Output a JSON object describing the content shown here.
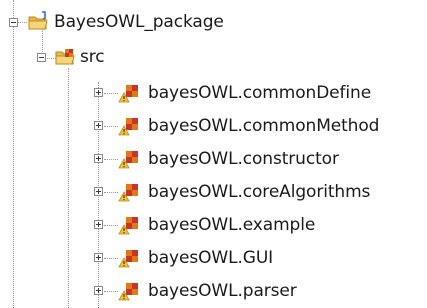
{
  "tree": {
    "project": {
      "label": "BayesOWL_package",
      "expanded": true,
      "icon": "java-project-folder-icon"
    },
    "source_folder": {
      "label": "src",
      "expanded": true,
      "icon": "source-folder-package-icon"
    },
    "packages": [
      {
        "label": "bayesOWL.commonDefine",
        "expanded": false,
        "icon": "package-icon"
      },
      {
        "label": "bayesOWL.commonMethod",
        "expanded": false,
        "icon": "package-icon"
      },
      {
        "label": "bayesOWL.constructor",
        "expanded": false,
        "icon": "package-icon"
      },
      {
        "label": "bayesOWL.coreAlgorithms",
        "expanded": false,
        "icon": "package-icon"
      },
      {
        "label": "bayesOWL.example",
        "expanded": false,
        "icon": "package-icon"
      },
      {
        "label": "bayesOWL.GUI",
        "expanded": false,
        "icon": "package-icon"
      },
      {
        "label": "bayesOWL.parser",
        "expanded": false,
        "icon": "package-icon"
      }
    ]
  },
  "colors": {
    "folder": "#e8b84a",
    "folder_dark": "#b98a1e",
    "package_orange": "#e07a16",
    "package_red": "#c8332a",
    "java_blue": "#3a6cc8",
    "warning_yellow": "#f4c430"
  }
}
